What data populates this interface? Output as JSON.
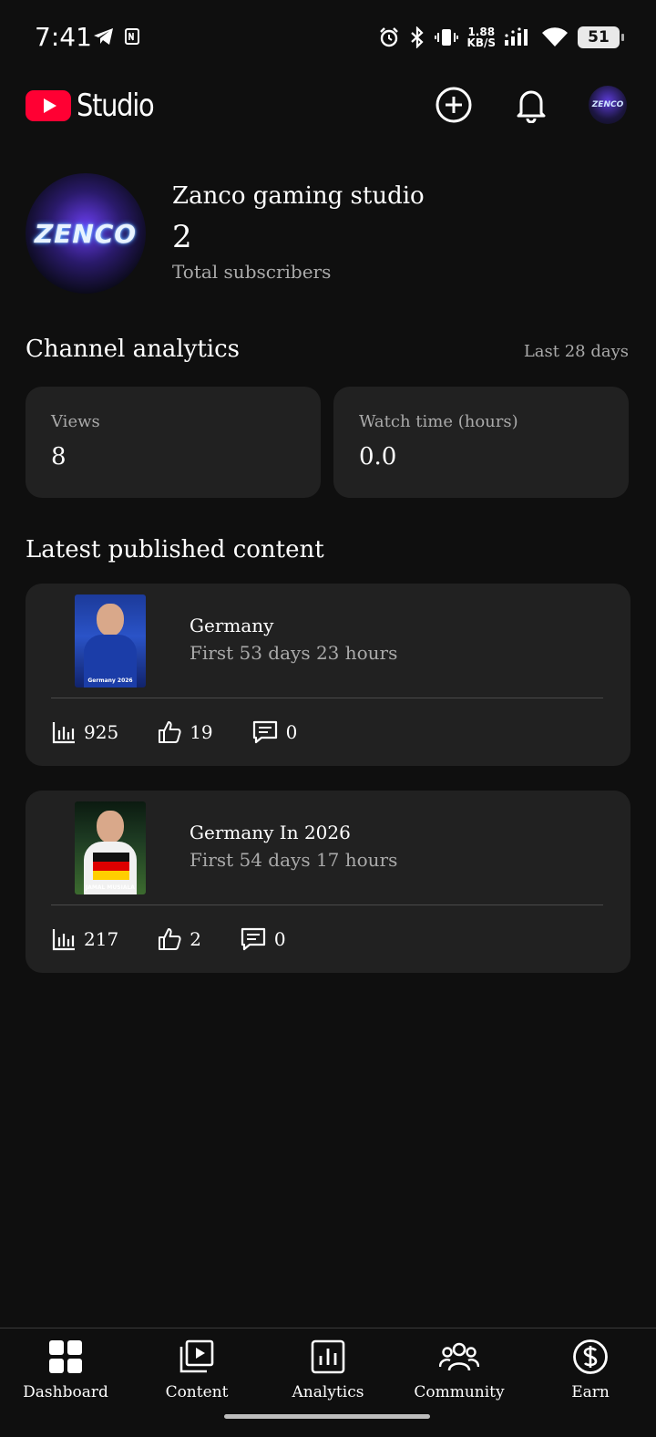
{
  "status_bar": {
    "time": "7:41",
    "net_speed_value": "1.88",
    "net_speed_unit": "KB/S",
    "battery": "51",
    "icons": [
      "telegram-icon",
      "nfc-icon",
      "alarm-icon",
      "bluetooth-icon",
      "vibrate-icon",
      "signal-icon",
      "wifi-icon",
      "battery-icon"
    ]
  },
  "app_bar": {
    "logo_text": "Studio",
    "avatar_text": "ZENCO",
    "icons": [
      "create-icon",
      "bell-icon"
    ]
  },
  "channel": {
    "name": "Zanco gaming studio",
    "subscriber_count": "2",
    "subscriber_label": "Total subscribers",
    "avatar_text": "ZENCO"
  },
  "analytics": {
    "title": "Channel analytics",
    "range": "Last 28 days",
    "cards": [
      {
        "label": "Views",
        "value": "8"
      },
      {
        "label": "Watch time (hours)",
        "value": "0.0"
      }
    ]
  },
  "latest": {
    "title": "Latest published content",
    "items": [
      {
        "title": "Germany",
        "subtitle": "First 53 days 23 hours",
        "thumb_caption": "Germany 2026",
        "views": "925",
        "likes": "19",
        "comments": "0"
      },
      {
        "title": "Germany In 2026",
        "subtitle": "First 54 days 17 hours",
        "thumb_caption": "JAMAL MUSIALA",
        "views": "217",
        "likes": "2",
        "comments": "0"
      }
    ]
  },
  "bottom_nav": {
    "items": [
      {
        "label": "Dashboard",
        "icon": "dashboard-icon"
      },
      {
        "label": "Content",
        "icon": "content-icon"
      },
      {
        "label": "Analytics",
        "icon": "analytics-icon"
      },
      {
        "label": "Community",
        "icon": "community-icon"
      },
      {
        "label": "Earn",
        "icon": "earn-icon"
      }
    ]
  },
  "colors": {
    "background": "#0f0f0f",
    "card": "#212121",
    "brand_red": "#ff0033",
    "secondary_text": "#aaaaaa"
  }
}
